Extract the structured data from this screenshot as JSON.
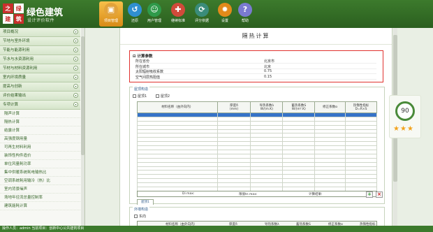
{
  "app": {
    "logo_chars": [
      "之",
      "绿",
      "建",
      "筑"
    ],
    "title": "绿色建筑",
    "subtitle": "设计评价软件"
  },
  "toolbar": [
    {
      "label": "项目管理",
      "icon": "folder-icon",
      "color": "#e2a23a",
      "active": true
    },
    {
      "label": "还原",
      "icon": "restore-icon",
      "color": "#2f8fd0",
      "active": false
    },
    {
      "label": "用户管理",
      "icon": "user-icon",
      "color": "#2f9a4a",
      "active": false
    },
    {
      "label": "继续标准",
      "icon": "standard-icon",
      "color": "#d04a3a",
      "active": false
    },
    {
      "label": "评分依据",
      "icon": "refresh-icon",
      "color": "#3a8c7a",
      "active": false
    },
    {
      "label": "设置",
      "icon": "gear-icon",
      "color": "#e28a1a",
      "active": false
    },
    {
      "label": "帮助",
      "icon": "help-icon",
      "color": "#7a7ad0",
      "active": false
    }
  ],
  "sidebar": {
    "sections": [
      {
        "label": "项目概况"
      },
      {
        "label": "节地与室外环境"
      },
      {
        "label": "节能与能源利用"
      },
      {
        "label": "节水与水资源利用"
      },
      {
        "label": "节材与材料资源利用"
      },
      {
        "label": "室内环境质量"
      },
      {
        "label": "提高与创新"
      },
      {
        "label": "评价结果输出"
      },
      {
        "label": "专项计算"
      }
    ],
    "items": [
      "隔声计算",
      "隔热计算",
      "结露计算",
      "高强度钢用量",
      "可再生材料利用",
      "装饰性构件造价",
      "单位风量耗功率",
      "集中供暖系统耗电输热比",
      "空调系统耗用输冷（热）比",
      "室内背景噪声",
      "场地年径流总量控制率",
      "建筑能耗计算"
    ]
  },
  "panel": {
    "title": "隔热计算",
    "calc": {
      "heading": "计算参数",
      "rows": [
        {
          "label": "所在省份",
          "value": "北京市"
        },
        {
          "label": "所在城市",
          "value": "北京"
        },
        {
          "label": "太阳辐射吸收系数",
          "value": "0.75"
        },
        {
          "label": "空气间层热阻值",
          "value": "0.15"
        }
      ]
    },
    "roof_group": {
      "title": "屋顶构造",
      "checkboxes": [
        "屋顶1",
        "屋顶2"
      ],
      "columns": [
        "材料名称（由外向内）",
        "厚度δ\n(mm)",
        "导热系数λ\nW/(m.K)",
        "蓄热系数S\nW/(m².K)",
        "修正系数α",
        "热惰性指标\nD=R×S"
      ],
      "footer": [
        "Di max:",
        "限值tn max:",
        "计算结果:"
      ],
      "tab_label": "屋顶1"
    },
    "wall_group": {
      "title": "外墙构造",
      "checkbox": "东向",
      "columns": [
        "材料名称（由外向内）",
        "厚度δ",
        "导热系数λ",
        "蓄热系数S",
        "修正系数α",
        "热惰性指标"
      ]
    },
    "score": {
      "value": "90",
      "stars": 3
    }
  },
  "status_bar": "操作人员：admin   当前项目：创新中心公共建筑项目"
}
